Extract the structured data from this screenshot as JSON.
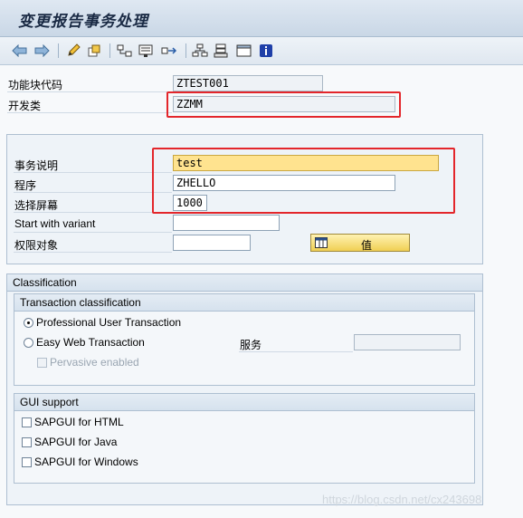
{
  "window": {
    "title": "变更报告事务处理"
  },
  "toolbar": {
    "icons": [
      "arrow-left-icon",
      "arrow-right-icon",
      "edit-pencil-icon",
      "other-object-icon",
      "where-used-icon",
      "display-object-list-icon",
      "navigation-arrows-icon",
      "hierarchy-icon",
      "transport-icon",
      "window-layout-icon",
      "info-icon"
    ]
  },
  "header": {
    "package_label": "功能块代码",
    "package_value": "ZTEST001",
    "devclass_label": "开发类",
    "devclass_value": "ZZMM"
  },
  "details": {
    "description_label": "事务说明",
    "description_value": "test",
    "program_label": "程序",
    "program_value": "ZHELLO",
    "screen_label": "选择屏幕",
    "screen_value": "1000",
    "variant_label": "Start with variant",
    "variant_value": "",
    "auth_label": "权限对象",
    "auth_value": "",
    "value_button_label": "值"
  },
  "classification": {
    "title": "Classification",
    "transaction_group": {
      "title": "Transaction classification",
      "professional_label": "Professional User Transaction",
      "easyweb_label": "Easy Web Transaction",
      "pervasive_label": "Pervasive enabled",
      "service_label": "服务",
      "service_value": "",
      "selected": "professional"
    },
    "gui_group": {
      "title": "GUI support",
      "html_label": "SAPGUI for HTML",
      "java_label": "SAPGUI for Java",
      "windows_label": "SAPGUI for Windows"
    }
  },
  "watermark": "https://blog.csdn.net/cx243698",
  "colors": {
    "highlight_box": "#e3262b",
    "focused_field": "#ffe38f",
    "value_button": "#f0cf53"
  }
}
